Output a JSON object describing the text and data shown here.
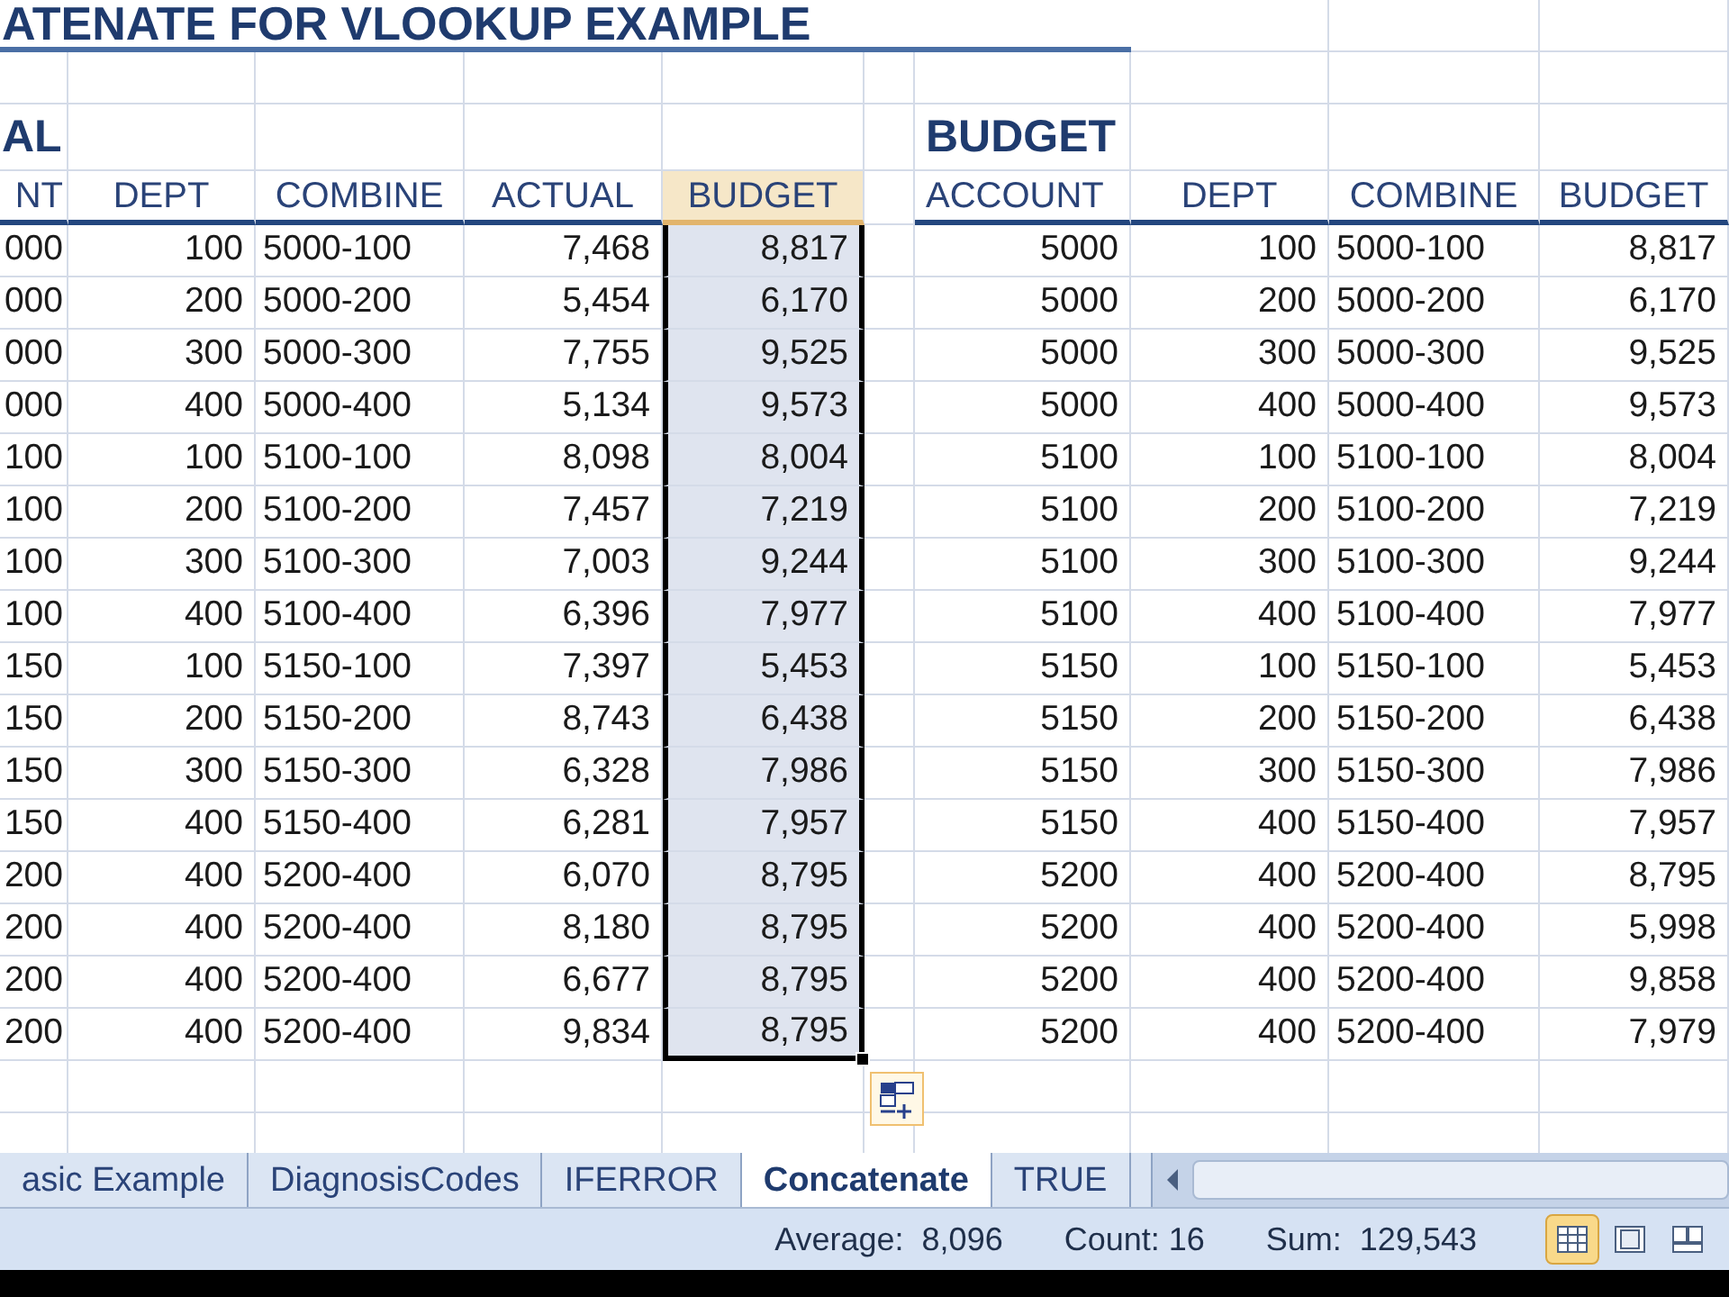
{
  "title": "ATENATE FOR VLOOKUP EXAMPLE",
  "left_table": {
    "section_title": "AL",
    "columns": [
      {
        "label": "NT",
        "selected": false
      },
      {
        "label": "DEPT",
        "selected": false
      },
      {
        "label": "COMBINE",
        "selected": false
      },
      {
        "label": "ACTUAL",
        "selected": false
      },
      {
        "label": "BUDGET",
        "selected": true
      }
    ],
    "rows": [
      [
        "000",
        "100",
        "5000-100",
        "7,468",
        "8,817"
      ],
      [
        "000",
        "200",
        "5000-200",
        "5,454",
        "6,170"
      ],
      [
        "000",
        "300",
        "5000-300",
        "7,755",
        "9,525"
      ],
      [
        "000",
        "400",
        "5000-400",
        "5,134",
        "9,573"
      ],
      [
        "100",
        "100",
        "5100-100",
        "8,098",
        "8,004"
      ],
      [
        "100",
        "200",
        "5100-200",
        "7,457",
        "7,219"
      ],
      [
        "100",
        "300",
        "5100-300",
        "7,003",
        "9,244"
      ],
      [
        "100",
        "400",
        "5100-400",
        "6,396",
        "7,977"
      ],
      [
        "150",
        "100",
        "5150-100",
        "7,397",
        "5,453"
      ],
      [
        "150",
        "200",
        "5150-200",
        "8,743",
        "6,438"
      ],
      [
        "150",
        "300",
        "5150-300",
        "6,328",
        "7,986"
      ],
      [
        "150",
        "400",
        "5150-400",
        "6,281",
        "7,957"
      ],
      [
        "200",
        "400",
        "5200-400",
        "6,070",
        "8,795"
      ],
      [
        "200",
        "400",
        "5200-400",
        "8,180",
        "8,795"
      ],
      [
        "200",
        "400",
        "5200-400",
        "6,677",
        "8,795"
      ],
      [
        "200",
        "400",
        "5200-400",
        "9,834",
        "8,795"
      ]
    ]
  },
  "right_table": {
    "section_title": "BUDGET",
    "columns": [
      "ACCOUNT",
      "DEPT",
      "COMBINE",
      "BUDGET"
    ],
    "rows": [
      [
        "5000",
        "100",
        "5000-100",
        "8,817"
      ],
      [
        "5000",
        "200",
        "5000-200",
        "6,170"
      ],
      [
        "5000",
        "300",
        "5000-300",
        "9,525"
      ],
      [
        "5000",
        "400",
        "5000-400",
        "9,573"
      ],
      [
        "5100",
        "100",
        "5100-100",
        "8,004"
      ],
      [
        "5100",
        "200",
        "5100-200",
        "7,219"
      ],
      [
        "5100",
        "300",
        "5100-300",
        "9,244"
      ],
      [
        "5100",
        "400",
        "5100-400",
        "7,977"
      ],
      [
        "5150",
        "100",
        "5150-100",
        "5,453"
      ],
      [
        "5150",
        "200",
        "5150-200",
        "6,438"
      ],
      [
        "5150",
        "300",
        "5150-300",
        "7,986"
      ],
      [
        "5150",
        "400",
        "5150-400",
        "7,957"
      ],
      [
        "5200",
        "400",
        "5200-400",
        "8,795"
      ],
      [
        "5200",
        "400",
        "5200-400",
        "5,998"
      ],
      [
        "5200",
        "400",
        "5200-400",
        "9,858"
      ],
      [
        "5200",
        "400",
        "5200-400",
        "7,979"
      ]
    ]
  },
  "sheet_tabs": [
    {
      "label": "asic Example",
      "selected": false
    },
    {
      "label": "DiagnosisCodes",
      "selected": false
    },
    {
      "label": "IFERROR",
      "selected": false
    },
    {
      "label": "Concatenate",
      "selected": true
    },
    {
      "label": "TRUE",
      "selected": false
    }
  ],
  "status_bar": {
    "summary": [
      "Average:  8,096",
      "Count: 16",
      "Sum:  129,543"
    ],
    "views": [
      {
        "kind": "normal",
        "selected": true
      },
      {
        "kind": "page_layout",
        "selected": false
      },
      {
        "kind": "page_break",
        "selected": false
      }
    ]
  }
}
